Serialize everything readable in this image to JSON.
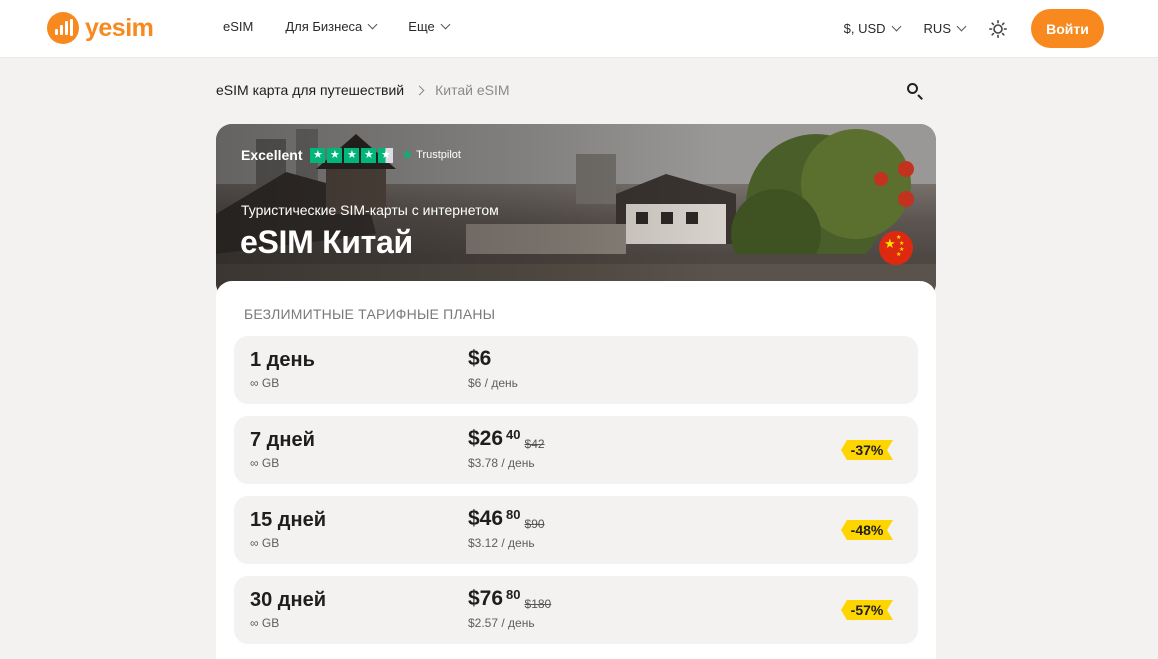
{
  "header": {
    "logo_text": "yesim",
    "nav": [
      {
        "label": "eSIM"
      },
      {
        "label": "Для Бизнеса"
      },
      {
        "label": "Еще"
      }
    ],
    "currency": "$, USD",
    "language": "RUS",
    "login_label": "Войти",
    "accent_color": "#f7891e"
  },
  "breadcrumb": {
    "parent": "eSIM карта для путешествий",
    "current": "Китай eSIM"
  },
  "hero": {
    "rating_word": "Excellent",
    "rating_brand": "Trustpilot",
    "rating_stars": 4.5,
    "subtitle": "Туристические SIM-карты с интернетом",
    "title": "eSIM Китай",
    "flag_icon": "china-flag-icon"
  },
  "plans": {
    "title": "БЕЗЛИМИТНЫЕ ТАРИФНЫЕ ПЛАНЫ",
    "items": [
      {
        "duration": "1 день",
        "data": "∞ GB",
        "price": "$6",
        "cents": "",
        "old_price": "",
        "per_day": "$6 / день",
        "discount": ""
      },
      {
        "duration": "7 дней",
        "data": "∞ GB",
        "price": "$26",
        "cents": "40",
        "old_price": "$42",
        "per_day": "$3.78 / день",
        "discount": "-37%"
      },
      {
        "duration": "15 дней",
        "data": "∞ GB",
        "price": "$46",
        "cents": "80",
        "old_price": "$90",
        "per_day": "$3.12 / день",
        "discount": "-48%"
      },
      {
        "duration": "30 дней",
        "data": "∞ GB",
        "price": "$76",
        "cents": "80",
        "old_price": "$180",
        "per_day": "$2.57 / день",
        "discount": "-57%"
      }
    ]
  },
  "colors": {
    "badge": "#ffd500",
    "trustpilot_green": "#00b67a"
  }
}
